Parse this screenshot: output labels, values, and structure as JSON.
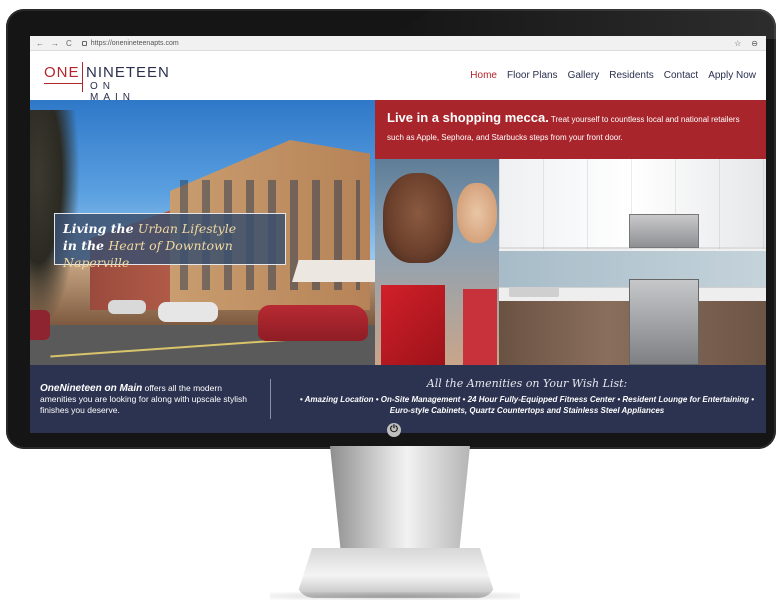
{
  "browser": {
    "back_icon": "←",
    "forward_icon": "→",
    "reload_icon": "C",
    "url": "https://onenineteenapts.com",
    "star_icon": "☆",
    "account_icon": "⊖"
  },
  "logo": {
    "one": "ONE",
    "nineteen": "NINETEEN",
    "on_main": "ON MAIN"
  },
  "nav": {
    "items": [
      "Home",
      "Floor Plans",
      "Gallery",
      "Residents",
      "Contact",
      "Apply Now"
    ],
    "active": "Home"
  },
  "hero": {
    "tagline_line1_a": "Living the ",
    "tagline_line1_b": "Urban Lifestyle",
    "tagline_line2_a": "in the ",
    "tagline_line2_b": "Heart of Downtown Naperville"
  },
  "promo": {
    "headline": "Live in a shopping mecca.",
    "body": " Treat yourself to countless local and national retailers such as Apple, Sephora, and Starbucks steps from your front door."
  },
  "info": {
    "brand": "OneNineteen on Main",
    "description": " offers all the modern amenities you are looking for along with upscale stylish finishes you deserve.",
    "amenities_title": "All the Amenities on Your Wish List:",
    "amenities_text": "•  Amazing Location  •  On-Site Management  •  24 Hour Fully-Equipped Fitness Center  •  Resident Lounge for Entertaining  •  Euro-style Cabinets, Quartz Countertops and Stainless Steel Appliances"
  },
  "monitor": {
    "power_icon": "⏻"
  },
  "colors": {
    "brand_red": "#b3252b",
    "navy": "#2c3350",
    "promo_red": "#a8252b"
  }
}
